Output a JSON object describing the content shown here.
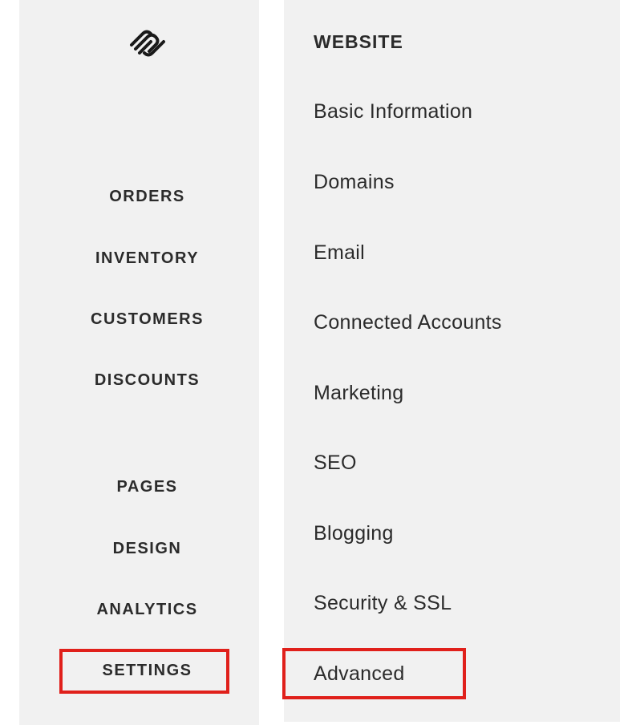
{
  "logo": {
    "icon": "squarespace-logo-icon"
  },
  "main_nav": {
    "items": [
      {
        "label": "ORDERS"
      },
      {
        "label": "INVENTORY"
      },
      {
        "label": "CUSTOMERS"
      },
      {
        "label": "DISCOUNTS"
      },
      {
        "label": "PAGES"
      },
      {
        "label": "DESIGN"
      },
      {
        "label": "ANALYTICS"
      },
      {
        "label": "SETTINGS",
        "highlighted": true
      }
    ]
  },
  "settings_menu": {
    "heading": "WEBSITE",
    "items": [
      {
        "label": "Basic Information"
      },
      {
        "label": "Domains"
      },
      {
        "label": "Email"
      },
      {
        "label": "Connected Accounts"
      },
      {
        "label": "Marketing"
      },
      {
        "label": "SEO"
      },
      {
        "label": "Blogging"
      },
      {
        "label": "Security & SSL"
      },
      {
        "label": "Advanced",
        "highlighted": true
      }
    ]
  },
  "colors": {
    "panel_bg": "#f1f1f1",
    "text": "#2b2b2b",
    "highlight": "#e0201b"
  }
}
